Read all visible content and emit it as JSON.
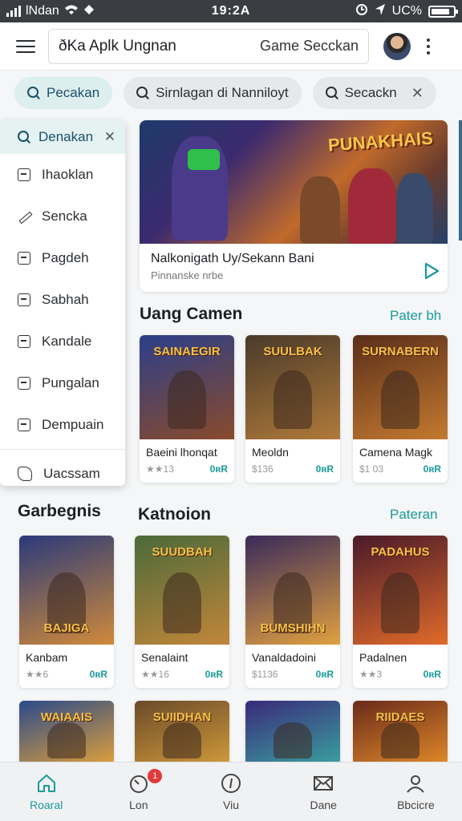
{
  "status": {
    "carrier": "lNdan",
    "time": "19:2A",
    "right": "UC%"
  },
  "appbar": {
    "search_text": "ðKa Aplk Ungnan",
    "search_secondary": "Game Secckan"
  },
  "chips": [
    {
      "label": "Pecakan",
      "active": true
    },
    {
      "label": "Sirnlagan di Nanniloyt",
      "active": false
    },
    {
      "label": "Secackn",
      "active": false
    }
  ],
  "dropdown": {
    "search_label": "Denakan",
    "items": [
      "Ihaoklan",
      "Sencka",
      "Pagdeh",
      "Sabhah",
      "Kandale",
      "Pungalan",
      "Dempuain"
    ],
    "footer": "Uacssam"
  },
  "hero": {
    "logo": "PUNAKHAIS",
    "title": "Nalkonigath Uy/Sekann Bani",
    "subtitle": "Pinnanske nrbe"
  },
  "section1": {
    "title": "Uang Camen",
    "link": "Pater bh"
  },
  "side_label": "Garbegnis",
  "section2": {
    "title": "Katnoion",
    "link": "Pateran"
  },
  "row1": [
    {
      "art_title": "SAINAEGIR",
      "name": "Baeini lhonqat",
      "meta_left": "★★13",
      "price": "0ʀR",
      "colors": [
        "#2b3f8a",
        "#8a4a2a"
      ]
    },
    {
      "art_title": "SUULBAK",
      "name": "Meoldn",
      "meta_left": "$136",
      "price": "0ʀR",
      "colors": [
        "#4a3a2a",
        "#b07a3a"
      ]
    },
    {
      "art_title": "SURNABERN",
      "name": "Camena Magk",
      "meta_left": "$1 03",
      "price": "0ʀR",
      "colors": [
        "#5a2e1a",
        "#c47a30"
      ]
    }
  ],
  "row2": [
    {
      "art_title": "",
      "art_bottom": "BAJIGA",
      "name": "Kanbam",
      "meta_left": "★★6",
      "price": "0ʀR",
      "colors": [
        "#2a3a7a",
        "#d08a3a"
      ]
    },
    {
      "art_title": "SUUDBAH",
      "art_bottom": "",
      "name": "Senalaint",
      "meta_left": "★★16",
      "price": "0ʀR",
      "colors": [
        "#4a6a3a",
        "#c2863a"
      ]
    },
    {
      "art_title": "",
      "art_bottom": "BUMSHIHN",
      "name": "Vanaldadoini",
      "meta_left": "$1136",
      "price": "0ʀR",
      "colors": [
        "#3a2a5a",
        "#e0a040"
      ]
    },
    {
      "art_title": "PADAHUS",
      "art_bottom": "",
      "name": "Padalnen",
      "meta_left": "★★3",
      "price": "0ʀR",
      "colors": [
        "#4a1a2a",
        "#e06a2a"
      ]
    }
  ],
  "row3": [
    {
      "art_title": "WAIAAIS",
      "colors": [
        "#2a4a8a",
        "#e0a03a"
      ]
    },
    {
      "art_title": "SUIIDHAN",
      "colors": [
        "#6a4a2a",
        "#d09a3a"
      ]
    },
    {
      "art_title": "",
      "colors": [
        "#3a2a7a",
        "#3aa0a0"
      ]
    },
    {
      "art_title": "RIIDAES",
      "colors": [
        "#6a2a1a",
        "#e08a2a"
      ]
    }
  ],
  "bottomnav": [
    {
      "label": "Roaral",
      "icon": "home-icon",
      "active": true
    },
    {
      "label": "Lon",
      "icon": "gauge-icon",
      "badge": "1"
    },
    {
      "label": "Viu",
      "icon": "compass-icon"
    },
    {
      "label": "Dane",
      "icon": "mail-icon"
    },
    {
      "label": "Bbcicre",
      "icon": "person-icon"
    }
  ]
}
